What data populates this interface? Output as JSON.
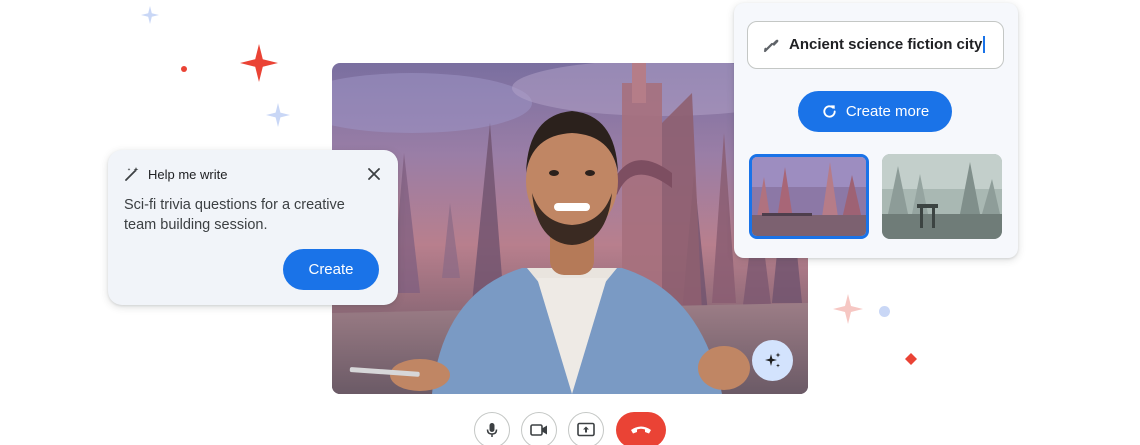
{
  "help_me_write": {
    "header_label": "Help me write",
    "prompt_text": "Sci-fi trivia questions for a creative team building session.",
    "create_label": "Create"
  },
  "background_generator": {
    "prompt_value": "Ancient science fiction city",
    "create_more_label": "Create more"
  },
  "colors": {
    "accent": "#1a73e8",
    "end_call": "#ea4335",
    "sparkle_red": "#ea4335",
    "sparkle_blue": "#d3e3fd"
  },
  "icons": {
    "write": "magic-wand-icon",
    "close": "close-icon",
    "brush": "brush-icon",
    "refresh": "refresh-icon",
    "effects": "sparkle-icon",
    "mic": "microphone-icon",
    "camera": "camera-icon",
    "present": "present-screen-icon",
    "hangup": "end-call-icon"
  }
}
